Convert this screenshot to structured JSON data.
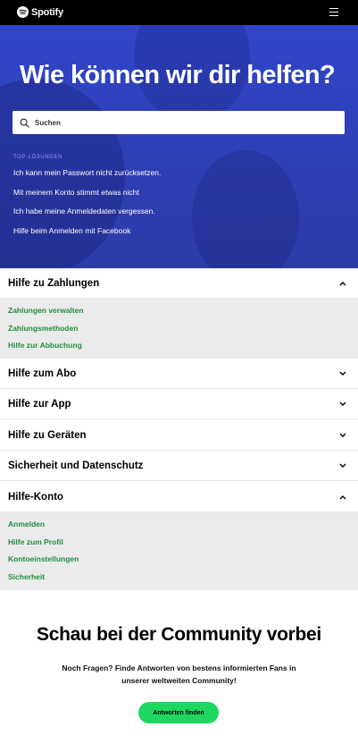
{
  "header": {
    "logo_text": "Spotify"
  },
  "hero": {
    "title": "Wie können wir dir helfen?",
    "search_placeholder": "Suchen",
    "top_label": "TOP-LÖSUNGEN",
    "top_links": [
      "Ich kann mein Passwort nicht zurücksetzen.",
      "Mit meinem Konto stimmt etwas nicht",
      "Ich habe meine Anmeldedaten vergessen.",
      "Hilfe beim Anmelden mit Facebook"
    ]
  },
  "accordion": [
    {
      "title": "Hilfe zu Zahlungen",
      "expanded": true,
      "links": [
        "Zahlungen verwalten",
        "Zahlungsmethoden",
        "Hilfe zur Abbuchung"
      ]
    },
    {
      "title": "Hilfe zum Abo",
      "expanded": false,
      "links": []
    },
    {
      "title": "Hilfe zur App",
      "expanded": false,
      "links": []
    },
    {
      "title": "Hilfe zu Geräten",
      "expanded": false,
      "links": []
    },
    {
      "title": "Sicherheit und Datenschutz",
      "expanded": false,
      "links": []
    },
    {
      "title": "Hilfe-Konto",
      "expanded": true,
      "links": [
        "Anmelden",
        "Hilfe zum Profil",
        "Kontoeinstellungen",
        "Sicherheit"
      ]
    }
  ],
  "community": {
    "title": "Schau bei der Community vorbei",
    "text": "Noch Fragen? Finde Antworten von bestens informierten Fans in unserer weltweiten Community!",
    "button_label": "Antworten finden"
  },
  "colors": {
    "hero_blue": "#2f41c0",
    "link_green": "#1e8e3e",
    "cta_green": "#1ed760"
  }
}
